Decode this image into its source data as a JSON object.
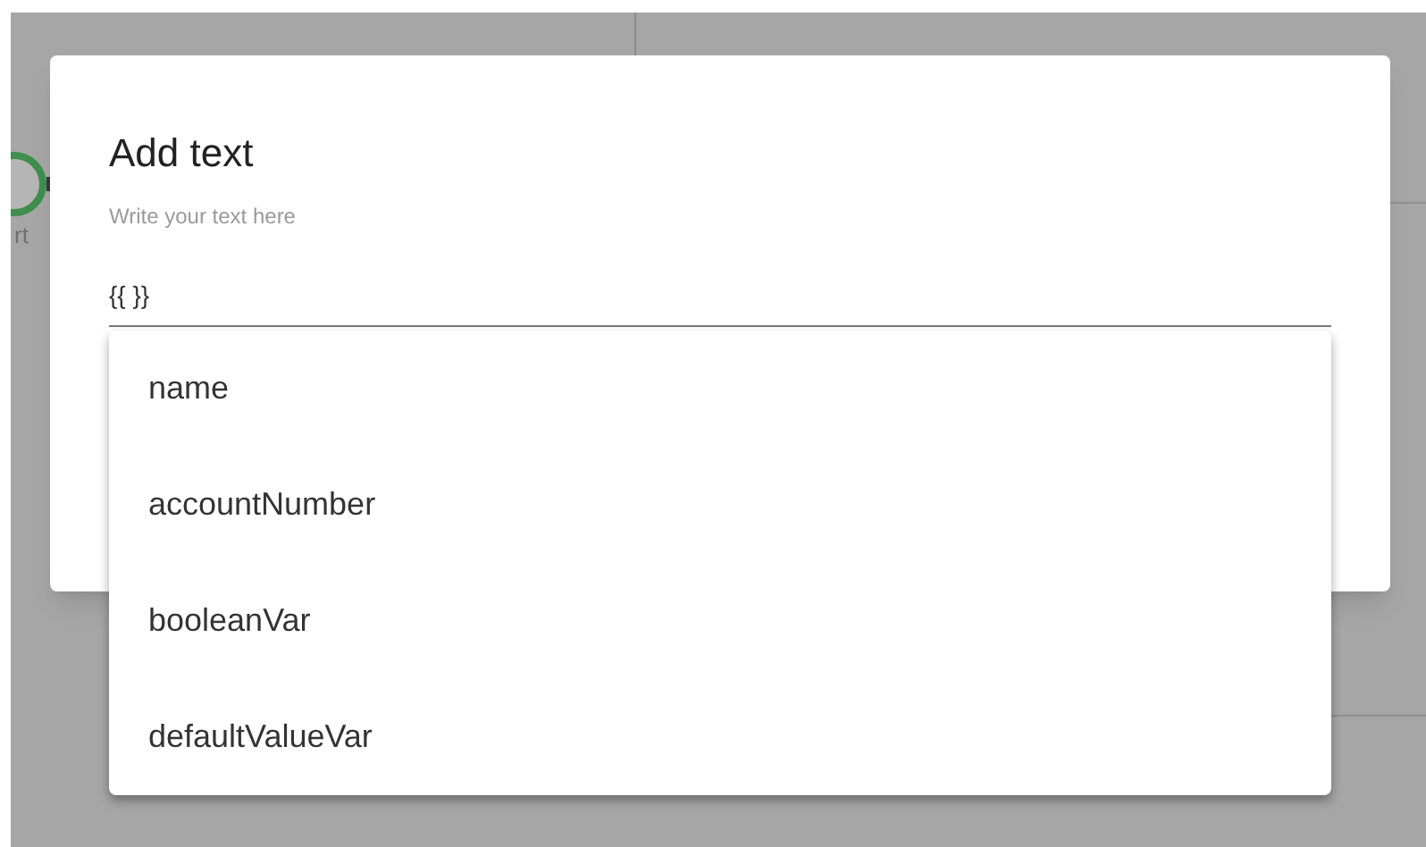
{
  "background": {
    "node_label": "rt"
  },
  "dialog": {
    "title": "Add text",
    "helper": "Write your text here",
    "field": {
      "value": "{{ }}"
    }
  },
  "menu": {
    "items": [
      {
        "label": "name"
      },
      {
        "label": "accountNumber"
      },
      {
        "label": "booleanVar"
      },
      {
        "label": "defaultValueVar"
      }
    ]
  }
}
